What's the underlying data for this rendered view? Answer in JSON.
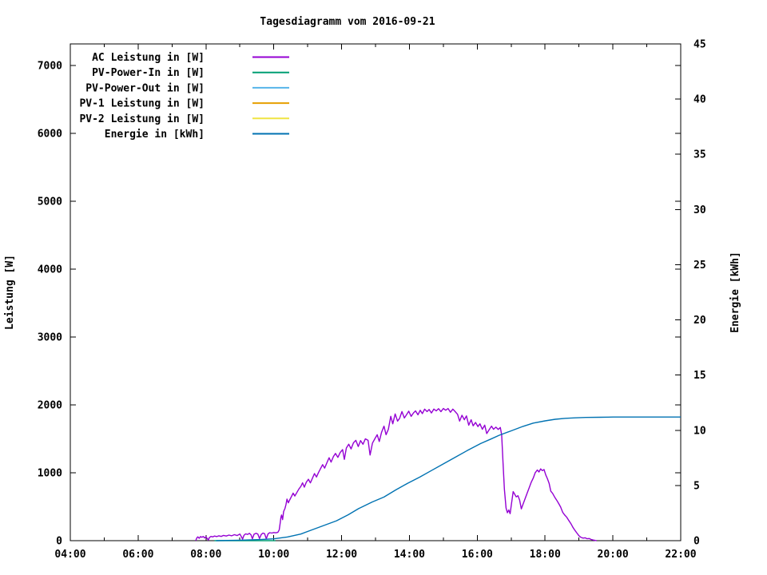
{
  "title": "Tagesdiagramm vom 2016-09-21",
  "axes": {
    "y_left_label": "Leistung [W]",
    "y_right_label": "Energie [kWh]"
  },
  "legend": {
    "items": [
      {
        "key": "ac",
        "label": "AC Leistung in [W]",
        "color": "#9400D3"
      },
      {
        "key": "pv_in",
        "label": "PV-Power-In in [W]",
        "color": "#009E73"
      },
      {
        "key": "pv_out",
        "label": "PV-Power-Out in [W]",
        "color": "#56B4E9"
      },
      {
        "key": "pv1",
        "label": "PV-1 Leistung in [W]",
        "color": "#E69F00"
      },
      {
        "key": "pv2",
        "label": "PV-2 Leistung in [W]",
        "color": "#F0E442"
      },
      {
        "key": "energie",
        "label": "Energie in [kWh]",
        "color": "#0072B2"
      }
    ]
  },
  "chart_data": {
    "type": "line",
    "title": "Tagesdiagramm vom 2016-09-21",
    "x": {
      "unit": "hour-of-day",
      "range_hours": [
        4,
        22
      ],
      "major_tick_step_hours": 2,
      "minor_tick_step_hours": 1,
      "tick_labels": [
        "04:00",
        "06:00",
        "08:00",
        "10:00",
        "12:00",
        "14:00",
        "16:00",
        "18:00",
        "20:00",
        "22:00"
      ]
    },
    "y_left": {
      "label": "Leistung [W]",
      "ticks": [
        0,
        1000,
        2000,
        3000,
        4000,
        5000,
        6000,
        7000
      ],
      "max": 7320
    },
    "y_right": {
      "label": "Energie [kWh]",
      "ticks": [
        0,
        5,
        10,
        15,
        20,
        25,
        30,
        35,
        40,
        45
      ],
      "max": 45
    },
    "grid": false,
    "legend_position": "top-left-inside",
    "series": [
      {
        "key": "ac",
        "name": "AC Leistung in [W]",
        "axis": "left",
        "color": "#9400D3",
        "points": [
          [
            7.7,
            0
          ],
          [
            7.73,
            40
          ],
          [
            7.76,
            55
          ],
          [
            7.8,
            35
          ],
          [
            7.84,
            60
          ],
          [
            7.88,
            50
          ],
          [
            7.92,
            62
          ],
          [
            7.96,
            40
          ],
          [
            8.0,
            58
          ],
          [
            8.04,
            30
          ],
          [
            8.07,
            8
          ],
          [
            8.1,
            45
          ],
          [
            8.15,
            62
          ],
          [
            8.2,
            55
          ],
          [
            8.25,
            68
          ],
          [
            8.32,
            60
          ],
          [
            8.38,
            72
          ],
          [
            8.45,
            62
          ],
          [
            8.52,
            78
          ],
          [
            8.6,
            68
          ],
          [
            8.68,
            82
          ],
          [
            8.76,
            72
          ],
          [
            8.84,
            88
          ],
          [
            8.92,
            75
          ],
          [
            9.0,
            98
          ],
          [
            9.05,
            55
          ],
          [
            9.08,
            22
          ],
          [
            9.12,
            78
          ],
          [
            9.17,
            100
          ],
          [
            9.23,
            92
          ],
          [
            9.28,
            108
          ],
          [
            9.33,
            85
          ],
          [
            9.37,
            28
          ],
          [
            9.42,
            95
          ],
          [
            9.48,
            110
          ],
          [
            9.53,
            98
          ],
          [
            9.58,
            32
          ],
          [
            9.63,
            92
          ],
          [
            9.68,
            112
          ],
          [
            9.73,
            102
          ],
          [
            9.78,
            28
          ],
          [
            9.83,
            100
          ],
          [
            9.88,
            118
          ],
          [
            9.94,
            112
          ],
          [
            10.0,
            120
          ],
          [
            10.06,
            115
          ],
          [
            10.12,
            122
          ],
          [
            10.16,
            160
          ],
          [
            10.19,
            260
          ],
          [
            10.21,
            345
          ],
          [
            10.23,
            378
          ],
          [
            10.26,
            310
          ],
          [
            10.29,
            430
          ],
          [
            10.33,
            475
          ],
          [
            10.36,
            530
          ],
          [
            10.39,
            612
          ],
          [
            10.43,
            558
          ],
          [
            10.47,
            600
          ],
          [
            10.52,
            648
          ],
          [
            10.57,
            700
          ],
          [
            10.62,
            658
          ],
          [
            10.68,
            708
          ],
          [
            10.74,
            762
          ],
          [
            10.8,
            800
          ],
          [
            10.85,
            852
          ],
          [
            10.9,
            788
          ],
          [
            10.96,
            862
          ],
          [
            11.02,
            905
          ],
          [
            11.08,
            852
          ],
          [
            11.14,
            922
          ],
          [
            11.2,
            988
          ],
          [
            11.26,
            938
          ],
          [
            11.32,
            1005
          ],
          [
            11.38,
            1062
          ],
          [
            11.44,
            1120
          ],
          [
            11.5,
            1068
          ],
          [
            11.57,
            1152
          ],
          [
            11.63,
            1222
          ],
          [
            11.69,
            1158
          ],
          [
            11.76,
            1242
          ],
          [
            11.82,
            1285
          ],
          [
            11.89,
            1228
          ],
          [
            11.96,
            1302
          ],
          [
            12.03,
            1342
          ],
          [
            12.08,
            1198
          ],
          [
            12.14,
            1365
          ],
          [
            12.21,
            1422
          ],
          [
            12.28,
            1352
          ],
          [
            12.35,
            1442
          ],
          [
            12.42,
            1478
          ],
          [
            12.49,
            1388
          ],
          [
            12.56,
            1475
          ],
          [
            12.63,
            1420
          ],
          [
            12.7,
            1500
          ],
          [
            12.78,
            1478
          ],
          [
            12.84,
            1262
          ],
          [
            12.91,
            1438
          ],
          [
            12.98,
            1502
          ],
          [
            13.05,
            1562
          ],
          [
            13.11,
            1462
          ],
          [
            13.18,
            1598
          ],
          [
            13.25,
            1688
          ],
          [
            13.31,
            1562
          ],
          [
            13.38,
            1642
          ],
          [
            13.45,
            1832
          ],
          [
            13.51,
            1722
          ],
          [
            13.58,
            1868
          ],
          [
            13.65,
            1762
          ],
          [
            13.71,
            1802
          ],
          [
            13.78,
            1902
          ],
          [
            13.85,
            1808
          ],
          [
            13.91,
            1852
          ],
          [
            13.98,
            1908
          ],
          [
            14.05,
            1832
          ],
          [
            14.12,
            1882
          ],
          [
            14.18,
            1912
          ],
          [
            14.25,
            1855
          ],
          [
            14.32,
            1922
          ],
          [
            14.38,
            1872
          ],
          [
            14.45,
            1938
          ],
          [
            14.52,
            1902
          ],
          [
            14.58,
            1932
          ],
          [
            14.65,
            1882
          ],
          [
            14.72,
            1940
          ],
          [
            14.79,
            1912
          ],
          [
            14.86,
            1945
          ],
          [
            14.93,
            1902
          ],
          [
            15.0,
            1948
          ],
          [
            15.07,
            1922
          ],
          [
            15.14,
            1948
          ],
          [
            15.21,
            1892
          ],
          [
            15.28,
            1938
          ],
          [
            15.35,
            1902
          ],
          [
            15.42,
            1862
          ],
          [
            15.48,
            1762
          ],
          [
            15.55,
            1848
          ],
          [
            15.62,
            1782
          ],
          [
            15.68,
            1838
          ],
          [
            15.75,
            1702
          ],
          [
            15.82,
            1782
          ],
          [
            15.88,
            1692
          ],
          [
            15.95,
            1742
          ],
          [
            16.02,
            1682
          ],
          [
            16.08,
            1722
          ],
          [
            16.15,
            1642
          ],
          [
            16.22,
            1702
          ],
          [
            16.28,
            1578
          ],
          [
            16.35,
            1635
          ],
          [
            16.42,
            1688
          ],
          [
            16.48,
            1642
          ],
          [
            16.55,
            1672
          ],
          [
            16.62,
            1638
          ],
          [
            16.68,
            1668
          ],
          [
            16.72,
            1560
          ],
          [
            16.76,
            1150
          ],
          [
            16.8,
            760
          ],
          [
            16.85,
            480
          ],
          [
            16.89,
            412
          ],
          [
            16.93,
            452
          ],
          [
            16.97,
            398
          ],
          [
            17.01,
            545
          ],
          [
            17.06,
            722
          ],
          [
            17.1,
            688
          ],
          [
            17.15,
            645
          ],
          [
            17.2,
            662
          ],
          [
            17.25,
            598
          ],
          [
            17.3,
            468
          ],
          [
            17.35,
            535
          ],
          [
            17.41,
            618
          ],
          [
            17.47,
            698
          ],
          [
            17.53,
            778
          ],
          [
            17.59,
            858
          ],
          [
            17.65,
            922
          ],
          [
            17.71,
            1002
          ],
          [
            17.77,
            1042
          ],
          [
            17.82,
            1012
          ],
          [
            17.87,
            1058
          ],
          [
            17.92,
            1032
          ],
          [
            17.97,
            1048
          ],
          [
            18.02,
            968
          ],
          [
            18.07,
            912
          ],
          [
            18.12,
            845
          ],
          [
            18.17,
            728
          ],
          [
            18.22,
            698
          ],
          [
            18.28,
            645
          ],
          [
            18.34,
            598
          ],
          [
            18.4,
            548
          ],
          [
            18.46,
            495
          ],
          [
            18.52,
            418
          ],
          [
            18.58,
            378
          ],
          [
            18.64,
            345
          ],
          [
            18.7,
            298
          ],
          [
            18.76,
            252
          ],
          [
            18.82,
            198
          ],
          [
            18.88,
            152
          ],
          [
            18.94,
            112
          ],
          [
            19.0,
            72
          ],
          [
            19.06,
            48
          ],
          [
            19.12,
            38
          ],
          [
            19.18,
            42
          ],
          [
            19.24,
            28
          ],
          [
            19.3,
            32
          ],
          [
            19.36,
            18
          ],
          [
            19.42,
            10
          ],
          [
            19.48,
            4
          ],
          [
            19.52,
            0
          ]
        ]
      },
      {
        "key": "pv_in",
        "name": "PV-Power-In in [W]",
        "axis": "left",
        "color": "#009E73",
        "points": [
          [
            8.25,
            0
          ],
          [
            8.6,
            0
          ],
          [
            9.0,
            0
          ],
          [
            9.4,
            0
          ],
          [
            9.8,
            0
          ],
          [
            10.05,
            0
          ]
        ]
      },
      {
        "key": "pv_out",
        "name": "PV-Power-Out in [W]",
        "axis": "left",
        "color": "#56B4E9",
        "points": []
      },
      {
        "key": "pv1",
        "name": "PV-1 Leistung in [W]",
        "axis": "left",
        "color": "#E69F00",
        "points": []
      },
      {
        "key": "pv2",
        "name": "PV-2 Leistung in [W]",
        "axis": "left",
        "color": "#F0E442",
        "points": []
      },
      {
        "key": "energie",
        "name": "Energie in [kWh]",
        "axis": "right",
        "color": "#0072B2",
        "points": [
          [
            8.3,
            0
          ],
          [
            9.0,
            0.04
          ],
          [
            9.6,
            0.1
          ],
          [
            10.0,
            0.17
          ],
          [
            10.4,
            0.33
          ],
          [
            10.8,
            0.6
          ],
          [
            11.1,
            0.95
          ],
          [
            11.5,
            1.4
          ],
          [
            11.85,
            1.8
          ],
          [
            12.2,
            2.35
          ],
          [
            12.5,
            2.9
          ],
          [
            12.9,
            3.5
          ],
          [
            13.25,
            3.95
          ],
          [
            13.6,
            4.6
          ],
          [
            13.95,
            5.2
          ],
          [
            14.3,
            5.75
          ],
          [
            14.65,
            6.35
          ],
          [
            15.0,
            6.95
          ],
          [
            15.35,
            7.55
          ],
          [
            15.7,
            8.15
          ],
          [
            16.1,
            8.8
          ],
          [
            16.4,
            9.2
          ],
          [
            16.65,
            9.55
          ],
          [
            17.0,
            9.95
          ],
          [
            17.35,
            10.35
          ],
          [
            17.65,
            10.65
          ],
          [
            18.0,
            10.85
          ],
          [
            18.3,
            11.0
          ],
          [
            18.6,
            11.08
          ],
          [
            18.9,
            11.13
          ],
          [
            19.2,
            11.16
          ],
          [
            19.6,
            11.18
          ],
          [
            20.0,
            11.2
          ],
          [
            21.0,
            11.2
          ],
          [
            22.0,
            11.2
          ]
        ]
      }
    ]
  }
}
